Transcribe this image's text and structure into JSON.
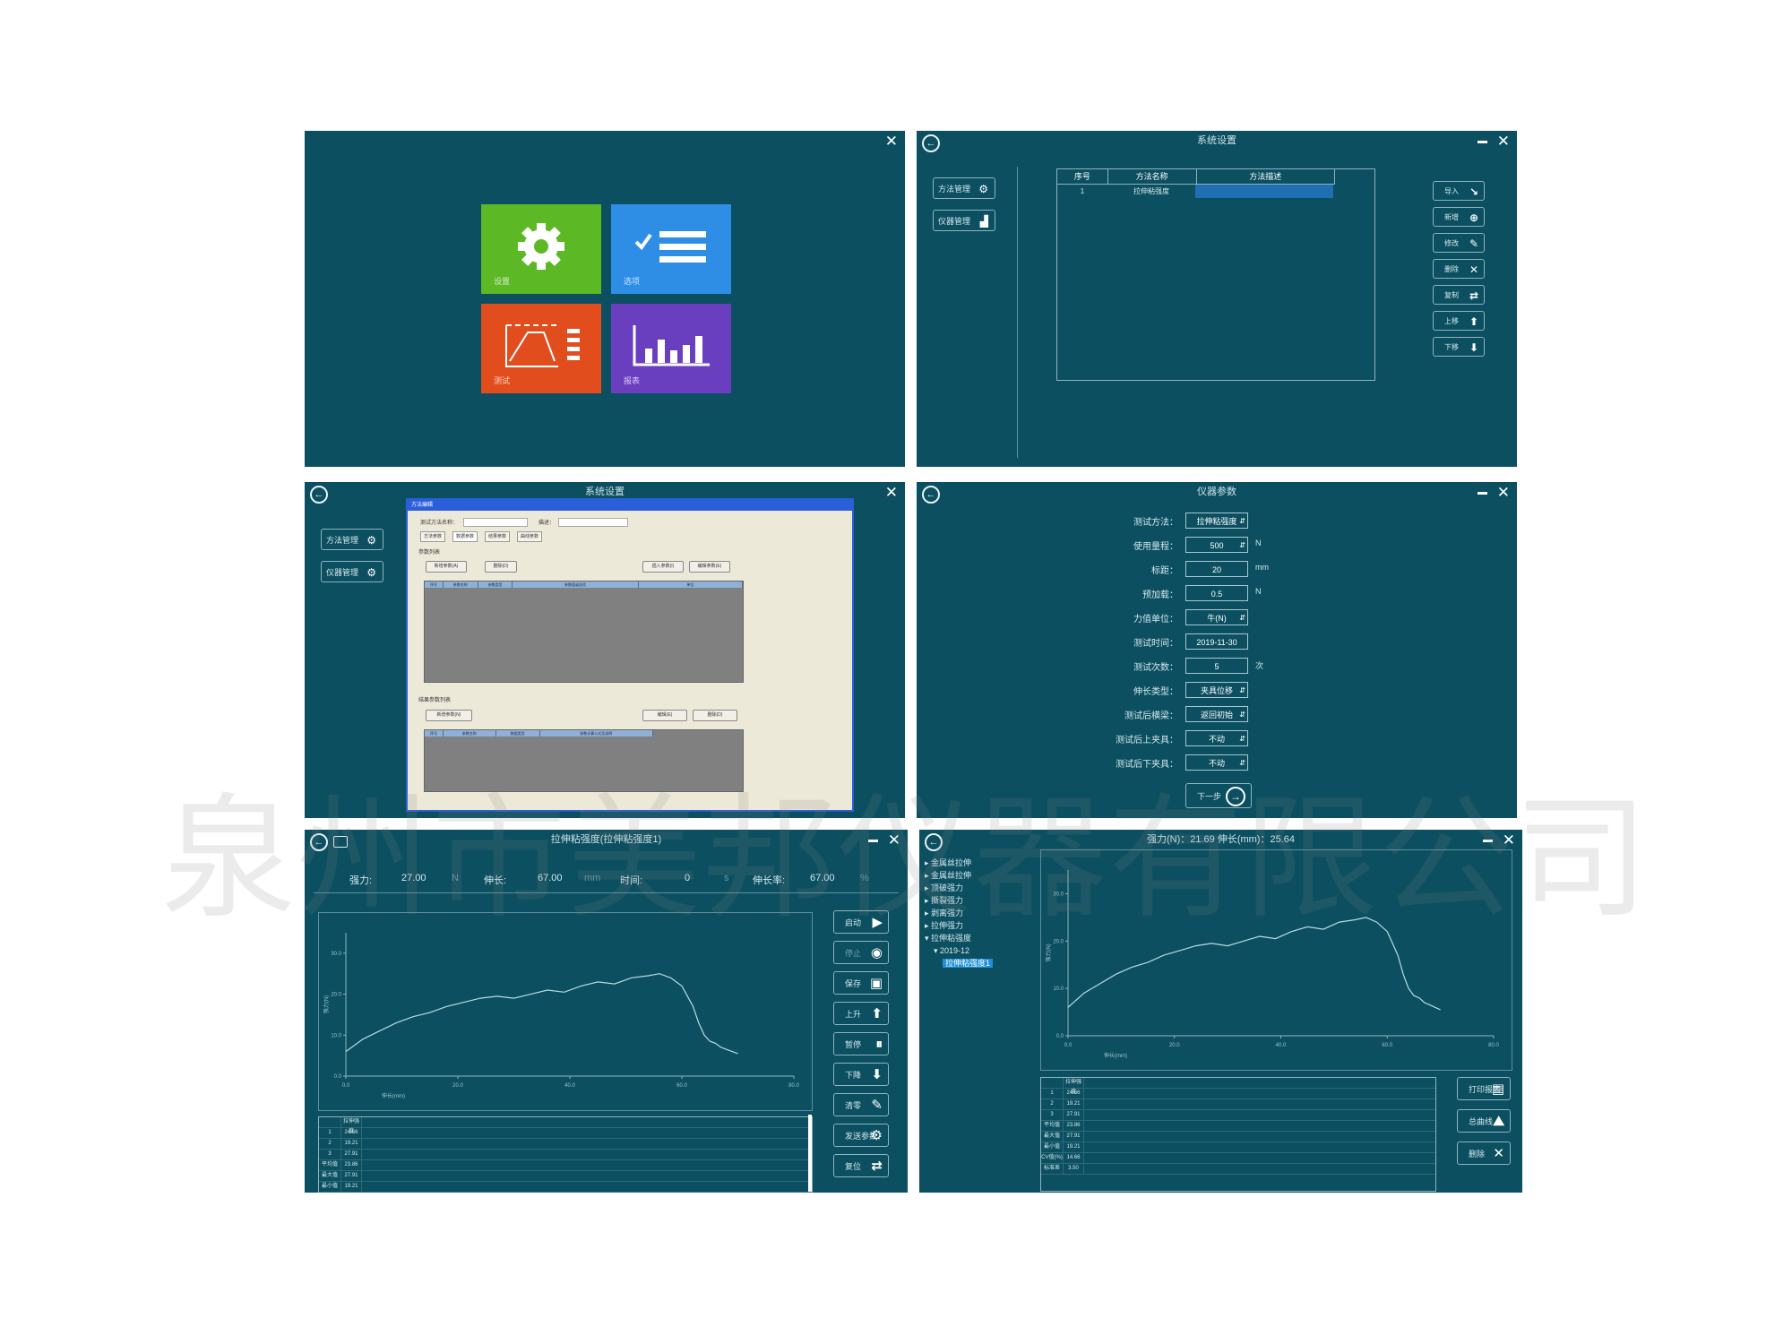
{
  "panel1": {
    "tiles": [
      {
        "label": "设置",
        "icon": "gear-icon",
        "color": "#5cb825"
      },
      {
        "label": "选项",
        "icon": "checklist-icon",
        "color": "#2e8ee6"
      },
      {
        "label": "测试",
        "icon": "curve-icon",
        "color": "#e24d1e"
      },
      {
        "label": "报表",
        "icon": "bar-chart-icon",
        "color": "#6a3fbf"
      }
    ]
  },
  "panel2": {
    "title": "系统设置",
    "side": [
      "方法管理",
      "仪器管理"
    ],
    "table": {
      "headers": [
        "序号",
        "方法名称",
        "方法描述"
      ],
      "row": [
        "1",
        "拉伸粘强度",
        ""
      ]
    },
    "actions": [
      "导入",
      "新增",
      "修改",
      "删除",
      "复制",
      "上移",
      "下移"
    ]
  },
  "panel3": {
    "title": "系统设置",
    "side": [
      "方法管理",
      "仪器管理"
    ],
    "dialog": {
      "title": "方法编辑",
      "fields": [
        "测试方法名称：",
        "描述："
      ],
      "tabs": [
        "方法参数",
        "数据参数",
        "结果参数",
        "曲线参数"
      ],
      "section1": "参数列表",
      "buttons1": [
        "新增参数(A)",
        "删除(D)",
        "插入参数(I)",
        "编辑参数(E)"
      ],
      "grid1": [
        "序号",
        "参数名称",
        "参数类型",
        "参数值或选项",
        "单位"
      ],
      "section2": "结果参数列表",
      "buttons2": [
        "新增参数(N)",
        "编辑(E)",
        "删除(D)"
      ],
      "grid2": [
        "序号",
        "参数名称",
        "数据类型",
        "参数计算公式及说明"
      ]
    }
  },
  "panel4": {
    "title": "仪器参数",
    "params": [
      {
        "label": "测试方法：",
        "value": "拉伸粘强度",
        "unit": "",
        "select": true
      },
      {
        "label": "使用量程：",
        "value": "500",
        "unit": "N",
        "select": true
      },
      {
        "label": "标距：",
        "value": "20",
        "unit": "mm",
        "select": false
      },
      {
        "label": "预加载：",
        "value": "0.5",
        "unit": "N",
        "select": false
      },
      {
        "label": "力值单位：",
        "value": "牛(N)",
        "unit": "",
        "select": true
      },
      {
        "label": "测试时间：",
        "value": "2019-11-30",
        "unit": "",
        "select": false
      },
      {
        "label": "测试次数：",
        "value": "5",
        "unit": "次",
        "select": false
      },
      {
        "label": "伸长类型：",
        "value": "夹具位移",
        "unit": "",
        "select": true
      },
      {
        "label": "测试后横梁：",
        "value": "返回初始",
        "unit": "",
        "select": true
      },
      {
        "label": "测试后上夹具：",
        "value": "不动",
        "unit": "",
        "select": true
      },
      {
        "label": "测试后下夹具：",
        "value": "不动",
        "unit": "",
        "select": true
      }
    ],
    "next_label": "下一步"
  },
  "panel5": {
    "title": "拉伸粘强度(拉伸粘强度1)",
    "readouts": [
      {
        "label": "强力:",
        "value": "27.00",
        "unit": "N"
      },
      {
        "label": "伸长:",
        "value": "67.00",
        "unit": "mm"
      },
      {
        "label": "时间:",
        "value": "0",
        "unit": "s"
      },
      {
        "label": "伸长率:",
        "value": "67.00",
        "unit": "%"
      }
    ],
    "controls": [
      "启动",
      "停止",
      "保存",
      "上升",
      "暂停",
      "下降",
      "清零",
      "发送参数",
      "复位"
    ],
    "table_header": "拉伸强度",
    "table_rows": [
      [
        "1",
        "24.66"
      ],
      [
        "2",
        "19.21"
      ],
      [
        "3",
        "27.91"
      ],
      [
        "平均值",
        "23.86"
      ],
      [
        "最大值",
        "27.91"
      ],
      [
        "最小值",
        "19.21"
      ]
    ]
  },
  "panel6": {
    "title": "强力(N)：21.69  伸长(mm)：25.64",
    "tree": [
      "金属丝拉伸",
      "金属丝拉伸",
      "顶破强力",
      "撕裂强力",
      "剥离强力",
      "拉伸强力",
      "拉伸粘强度",
      "2019-12",
      "拉伸粘强度1"
    ],
    "table_header": "拉伸强度",
    "table_rows": [
      [
        "1",
        "24.66"
      ],
      [
        "2",
        "19.21"
      ],
      [
        "3",
        "27.91"
      ],
      [
        "平均值",
        "23.86"
      ],
      [
        "最大值",
        "27.91"
      ],
      [
        "最小值",
        "19.21"
      ],
      [
        "CV值(%)",
        "14.66"
      ],
      [
        "标准差",
        "3.50"
      ]
    ],
    "actions": [
      "打印报表",
      "总曲线",
      "删除"
    ]
  },
  "chart_data": [
    {
      "type": "line",
      "xlabel": "伸长(mm)",
      "ylabel": "强力(N)",
      "xlim": [
        0,
        80
      ],
      "ylim": [
        0,
        35
      ],
      "x_ticks": [
        0,
        20,
        40,
        60,
        80
      ],
      "y_ticks": [
        0,
        10,
        20,
        30
      ],
      "series": [
        {
          "x": [
            0,
            3,
            6,
            9,
            12,
            15,
            18,
            21,
            24,
            27,
            30,
            33,
            36,
            39,
            42,
            45,
            48,
            51,
            54,
            56,
            58,
            60,
            62,
            63,
            64,
            65,
            66,
            67,
            68,
            69,
            70
          ],
          "y": [
            6,
            9,
            11,
            13,
            14.5,
            15.5,
            17,
            18,
            19,
            19.5,
            19,
            20,
            21,
            20.5,
            22,
            23,
            22.5,
            24,
            24.5,
            25,
            24,
            22,
            17,
            13,
            10,
            8.5,
            8,
            7,
            6.5,
            6,
            5.5
          ]
        }
      ]
    },
    {
      "type": "line",
      "xlabel": "伸长(mm)",
      "ylabel": "强力(N)",
      "xlim": [
        0,
        80
      ],
      "ylim": [
        0,
        35
      ],
      "x_ticks": [
        0,
        20,
        40,
        60,
        80
      ],
      "y_ticks": [
        0,
        10,
        20,
        30
      ],
      "series": [
        {
          "x": [
            0,
            3,
            6,
            9,
            12,
            15,
            18,
            21,
            24,
            27,
            30,
            33,
            36,
            39,
            42,
            45,
            48,
            51,
            54,
            56,
            58,
            60,
            62,
            63,
            64,
            65,
            66,
            67,
            68,
            69,
            70
          ],
          "y": [
            6,
            9,
            11,
            13,
            14.5,
            15.5,
            17,
            18,
            19,
            19.5,
            19,
            20,
            21,
            20.5,
            22,
            23,
            22.5,
            24,
            24.5,
            25,
            24,
            22,
            17,
            13,
            10,
            8.5,
            8,
            7,
            6.5,
            6,
            5.5
          ]
        }
      ]
    }
  ],
  "watermark": [
    "泉",
    "州",
    "市",
    "美",
    "邦",
    "仪",
    "器",
    "有",
    "限",
    "公",
    "司"
  ]
}
